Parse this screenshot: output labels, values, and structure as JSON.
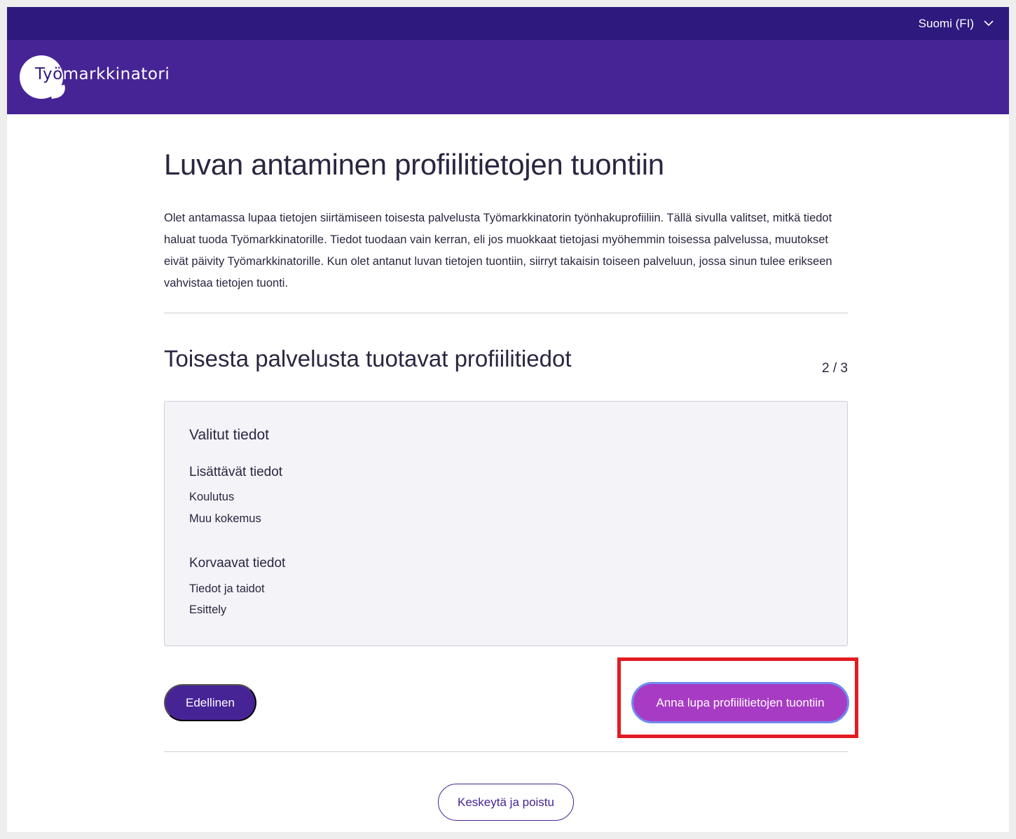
{
  "topbar": {
    "language_label": "Suomi (FI)"
  },
  "header": {
    "logo_text_part1": "Työ",
    "logo_text_part2": "markkinatori"
  },
  "main": {
    "title": "Luvan antaminen profiilitietojen tuontiin",
    "intro": "Olet antamassa lupaa tietojen siirtämiseen toisesta palvelusta Työmarkkinatorin työnhakuprofiiliin. Tällä sivulla valitset, mitkä tiedot haluat tuoda Työmarkkinatorille. Tiedot tuodaan vain kerran, eli jos muokkaat tietojasi myöhemmin toisessa palvelussa, muutokset eivät päivity Työmarkkinatorille. Kun olet antanut luvan tietojen tuontiin, siirryt takaisin toiseen palveluun, jossa sinun tulee erikseen vahvistaa tietojen tuonti.",
    "section_title": "Toisesta palvelusta tuotavat profiilitiedot",
    "step": "2 / 3",
    "card": {
      "title": "Valitut tiedot",
      "groups": [
        {
          "title": "Lisättävät tiedot",
          "items": [
            "Koulutus",
            "Muu kokemus"
          ]
        },
        {
          "title": "Korvaavat tiedot",
          "items": [
            "Tiedot ja taidot",
            "Esittely"
          ]
        }
      ]
    },
    "buttons": {
      "previous": "Edellinen",
      "approve": "Anna lupa profiilitietojen tuontiin",
      "cancel": "Keskeytä ja poistu"
    }
  },
  "colors": {
    "topbar": "#2e1a7e",
    "header": "#472496",
    "approve_button": "#a83bc4",
    "highlight": "#e31b23"
  }
}
